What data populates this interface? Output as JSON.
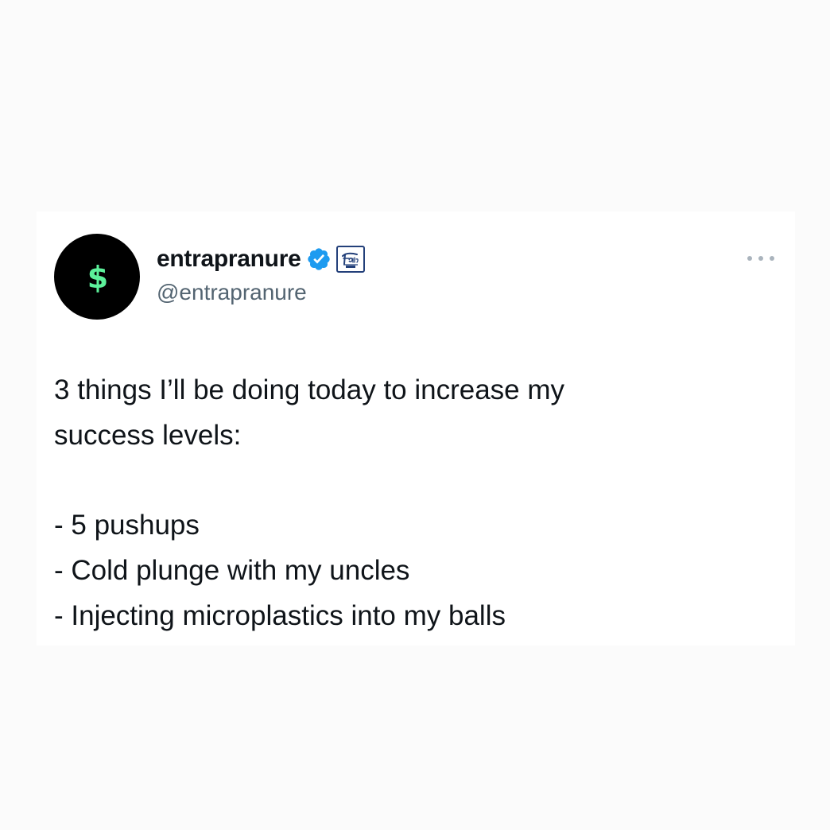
{
  "tweet": {
    "avatar_symbol": "$",
    "avatar_bg": "#000000",
    "avatar_symbol_color": "#5cf09a",
    "display_name": "entrapranure",
    "handle": "@entrapranure",
    "verified_color": "#1d9bf0",
    "affiliate_badge_icon": "friday-beers-badge-icon",
    "more_icon": "ellipsis-icon",
    "text": {
      "intro_line_1": "3 things I’ll be doing today to increase my",
      "intro_line_2": "success levels:",
      "items": [
        "- 5 pushups",
        "- Cold plunge with my uncles",
        "- Injecting microplastics into my balls"
      ]
    }
  }
}
